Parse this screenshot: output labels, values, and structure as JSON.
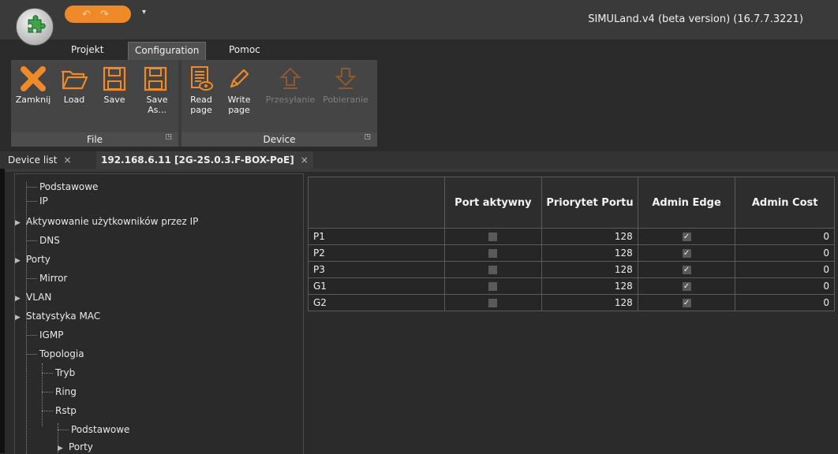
{
  "window": {
    "title": "SIMULand.v4 (beta version) (16.7.7.3221)"
  },
  "menu_tabs": [
    "Projekt",
    "Configuration",
    "Pomoc"
  ],
  "ribbon": {
    "file_group": {
      "label": "File",
      "buttons": [
        {
          "label": "Zamknij",
          "icon": "close-icon"
        },
        {
          "label": "Load",
          "icon": "folder-open-icon"
        },
        {
          "label": "Save",
          "icon": "save-icon"
        },
        {
          "label": "Save As...",
          "icon": "save-as-icon"
        }
      ]
    },
    "device_group": {
      "label": "Device",
      "buttons": [
        {
          "label": "Read page",
          "icon": "read-page-icon"
        },
        {
          "label": "Write page",
          "icon": "write-page-icon"
        },
        {
          "label": "Przesyłanie",
          "icon": "upload-icon",
          "disabled": true
        },
        {
          "label": "Pobieranie",
          "icon": "download-icon",
          "disabled": true
        }
      ]
    }
  },
  "doc_tabs": [
    "Device list",
    "192.168.6.11 [2G-2S.0.3.F-BOX-PoE]"
  ],
  "tree": [
    "Podstawowe",
    "IP",
    "Aktywowanie użytkowników przez IP",
    "DNS",
    "Porty",
    "Mirror",
    "VLAN",
    "Statystyka MAC",
    "IGMP",
    "Topologia",
    "Tryb",
    "Ring",
    "Rstp",
    "Podstawowe",
    "Porty"
  ],
  "table": {
    "columns": [
      "",
      "Port aktywny",
      "Priorytet Portu",
      "Admin Edge",
      "Admin Cost"
    ],
    "rows": [
      {
        "port": "P1",
        "active": false,
        "priority": "128",
        "edge": true,
        "cost": "0"
      },
      {
        "port": "P2",
        "active": false,
        "priority": "128",
        "edge": true,
        "cost": "0"
      },
      {
        "port": "P3",
        "active": false,
        "priority": "128",
        "edge": true,
        "cost": "0"
      },
      {
        "port": "G1",
        "active": false,
        "priority": "128",
        "edge": true,
        "cost": "0"
      },
      {
        "port": "G2",
        "active": false,
        "priority": "128",
        "edge": true,
        "cost": "0"
      }
    ]
  },
  "colors": {
    "accent": "#ee8a2a",
    "background": "#2b2b2b"
  }
}
